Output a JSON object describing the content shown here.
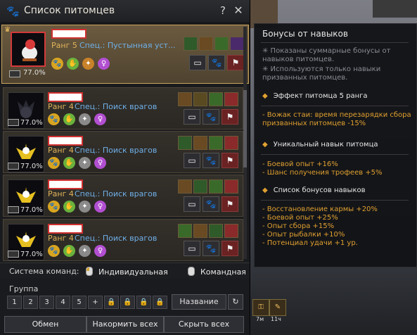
{
  "window": {
    "title": "Список питомцев",
    "help_label": "?",
    "close_label": "✕"
  },
  "pets": [
    {
      "rank": "Ранг 5",
      "spec": "Спец.: Пустынная уст...",
      "percent": "77.0%",
      "selected": true,
      "skill_fill_color": "#a03030"
    },
    {
      "rank": "Ранг 4",
      "spec": "Спец.: Поиск врагов",
      "percent": "77.0%",
      "selected": false
    },
    {
      "rank": "Ранг 4",
      "spec": "Спец.: Поиск врагов",
      "percent": "77.0%",
      "selected": false
    },
    {
      "rank": "Ранг 4",
      "spec": "Спец.: Поиск врагов",
      "percent": "77.0%",
      "selected": false
    },
    {
      "rank": "Ранг 4",
      "spec": "Спец.: Поиск врагов",
      "percent": "77.0%",
      "selected": false
    }
  ],
  "command_system": {
    "label": "Система команд:",
    "individual": "Индивидуальная",
    "group": "Командная"
  },
  "group": {
    "label": "Группа",
    "buttons": [
      "1",
      "2",
      "3",
      "4",
      "5",
      "+"
    ],
    "name_button": "Название",
    "refresh_icon": "↻"
  },
  "bottom": {
    "exchange": "Обмен",
    "feed_all": "Накормить всех",
    "hide_all": "Скрыть всех"
  },
  "tooltip": {
    "title": "Бонусы от навыков",
    "notes": [
      "✳ Показаны суммарные бонусы от навыков питомцев.",
      "✳ Используются только навыки призванных питомцев."
    ],
    "sections": [
      {
        "header": "Эффект питомца 5 ранга",
        "effects": [
          "- Вожак стаи: время перезарядки сбора призванных питомцев -15%"
        ]
      },
      {
        "header": "Уникальный навык питомца",
        "effects": [
          "- Боевой опыт +16%",
          "- Шанс получения трофеев +5%"
        ]
      },
      {
        "header": "Список бонусов навыков",
        "effects": [
          "- Восстановление кармы +20%",
          "- Боевой опыт +25%",
          "- Опыт сбора +15%",
          "- Опыт рыбалки +10%",
          "- Потенциал удачи +1 ур."
        ]
      }
    ]
  },
  "hotbar": [
    {
      "label": "7м"
    },
    {
      "label": "11ч"
    }
  ],
  "colors": {
    "rank_text": "#e0b35a",
    "spec_text": "#6fb0e8",
    "bonus_text": "#e0a030",
    "selected_border": "#c9a45a"
  }
}
